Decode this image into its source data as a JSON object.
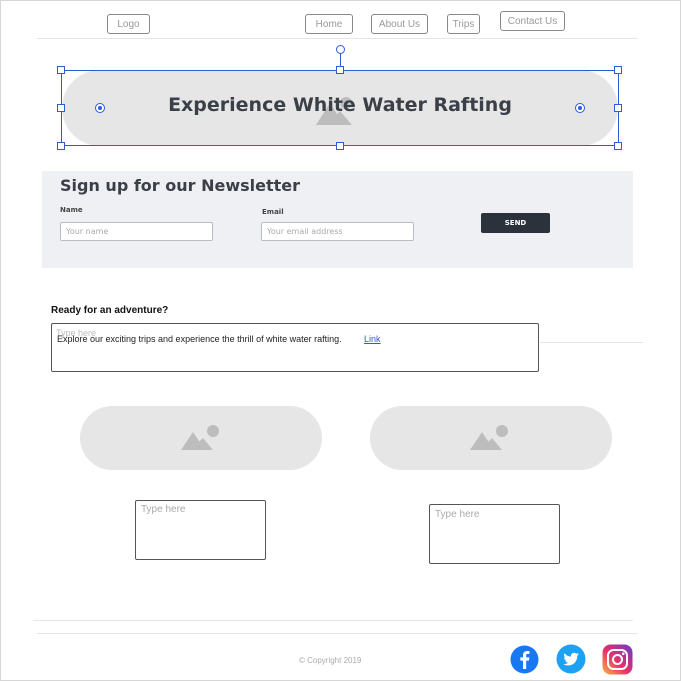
{
  "nav": {
    "logo": "Logo",
    "home": "Home",
    "about": "About Us",
    "trips": "Trips",
    "contact": "Contact Us"
  },
  "hero": {
    "title": "Experience White Water Rafting"
  },
  "newsletter": {
    "title": "Sign up for our Newsletter",
    "name_label": "Name",
    "name_placeholder": "Your name",
    "email_label": "Email",
    "email_placeholder": "Your email address",
    "send_label": "SEND"
  },
  "adventure": {
    "heading": "Ready for an adventure?",
    "placeholder": "Type here",
    "text": "Explore our exciting trips and experience the thrill of white water rafting.",
    "link": "Link"
  },
  "cards": [
    {
      "text_placeholder": "Type here"
    },
    {
      "text_placeholder": "Type here"
    }
  ],
  "footer": {
    "copyright": "© Copyright 2019",
    "social": [
      "facebook-icon",
      "twitter-icon",
      "instagram-icon"
    ]
  },
  "colors": {
    "selection": "#2f5bd5",
    "placeholder_fill": "#e6e6e6",
    "newsletter_bg": "#eef0f4",
    "send_button": "#2b323c",
    "facebook": "#1877f2",
    "twitter": "#1da1f2"
  }
}
